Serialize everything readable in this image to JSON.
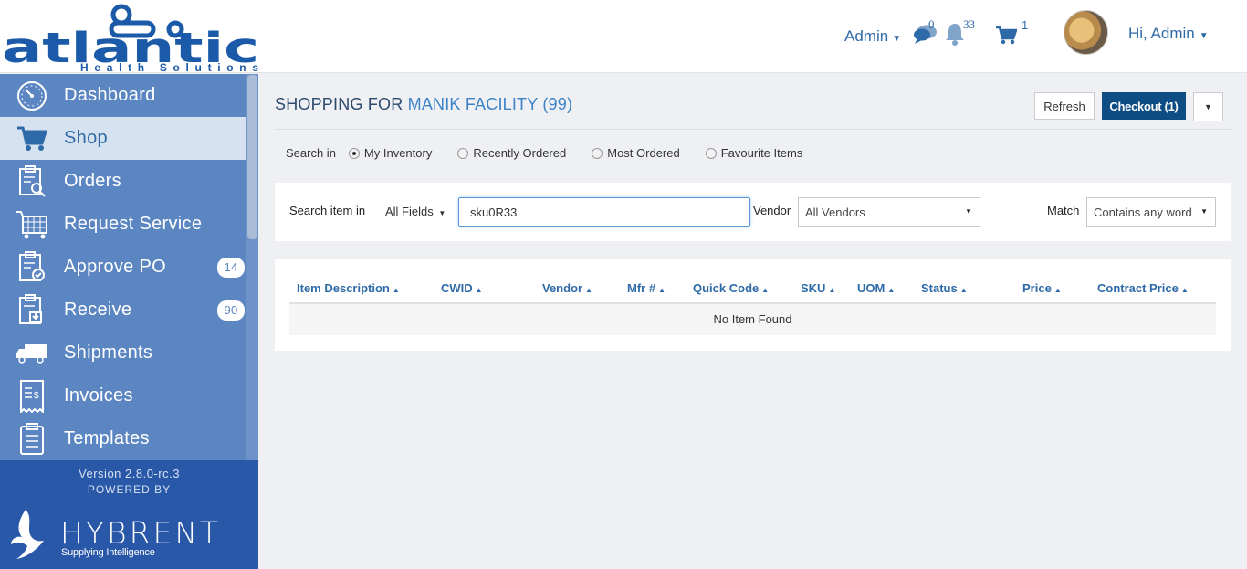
{
  "brand": {
    "logo_word": "atlantic",
    "logo_sub": "Health Solutions",
    "logo_color": "#1b5aa8"
  },
  "header": {
    "admin_label": "Admin",
    "messages_count": "0",
    "notifications_count": "33",
    "cart_count": "1",
    "greeting": "Hi, Admin"
  },
  "sidebar": {
    "items": [
      {
        "label": "Dashboard",
        "icon": "dashboard-icon"
      },
      {
        "label": "Shop",
        "icon": "cart-icon",
        "active": true
      },
      {
        "label": "Orders",
        "icon": "orders-icon"
      },
      {
        "label": "Request Service",
        "icon": "request-service-icon"
      },
      {
        "label": "Approve PO",
        "icon": "approve-po-icon",
        "badge": "14"
      },
      {
        "label": "Receive",
        "icon": "receive-icon",
        "badge": "90"
      },
      {
        "label": "Shipments",
        "icon": "truck-icon"
      },
      {
        "label": "Invoices",
        "icon": "invoice-icon"
      },
      {
        "label": "Templates",
        "icon": "templates-icon"
      }
    ],
    "version": "Version 2.8.0-rc.3",
    "powered_by": "POWERED BY",
    "powered_brand": "HYBRENT",
    "powered_tagline": "Supplying Intelligence"
  },
  "main": {
    "title_prefix": "SHOPPING FOR",
    "facility": "MANIK FACILITY (99)",
    "refresh_label": "Refresh",
    "checkout_label": "Checkout (1)",
    "search_in_label": "Search in",
    "search_in_options": [
      "My Inventory",
      "Recently Ordered",
      "Most Ordered",
      "Favourite Items"
    ],
    "search_in_selected": "My Inventory",
    "search_item_label": "Search item in",
    "field_filter": "All Fields",
    "search_value": "sku0R33",
    "vendor_label": "Vendor",
    "vendor_value": "All Vendors",
    "match_label": "Match",
    "match_value": "Contains any word",
    "columns": [
      "Item Description",
      "CWID",
      "Vendor",
      "Mfr #",
      "Quick Code",
      "SKU",
      "UOM",
      "Status",
      "Price",
      "Contract Price"
    ],
    "empty_message": "No Item Found"
  },
  "colors": {
    "sidebar": "#5b86c2",
    "sidebar_active": "#d6e2ef",
    "sidebar_footer": "#2a58a8",
    "accent": "#2f6aa8",
    "checkout": "#0e4c84"
  }
}
